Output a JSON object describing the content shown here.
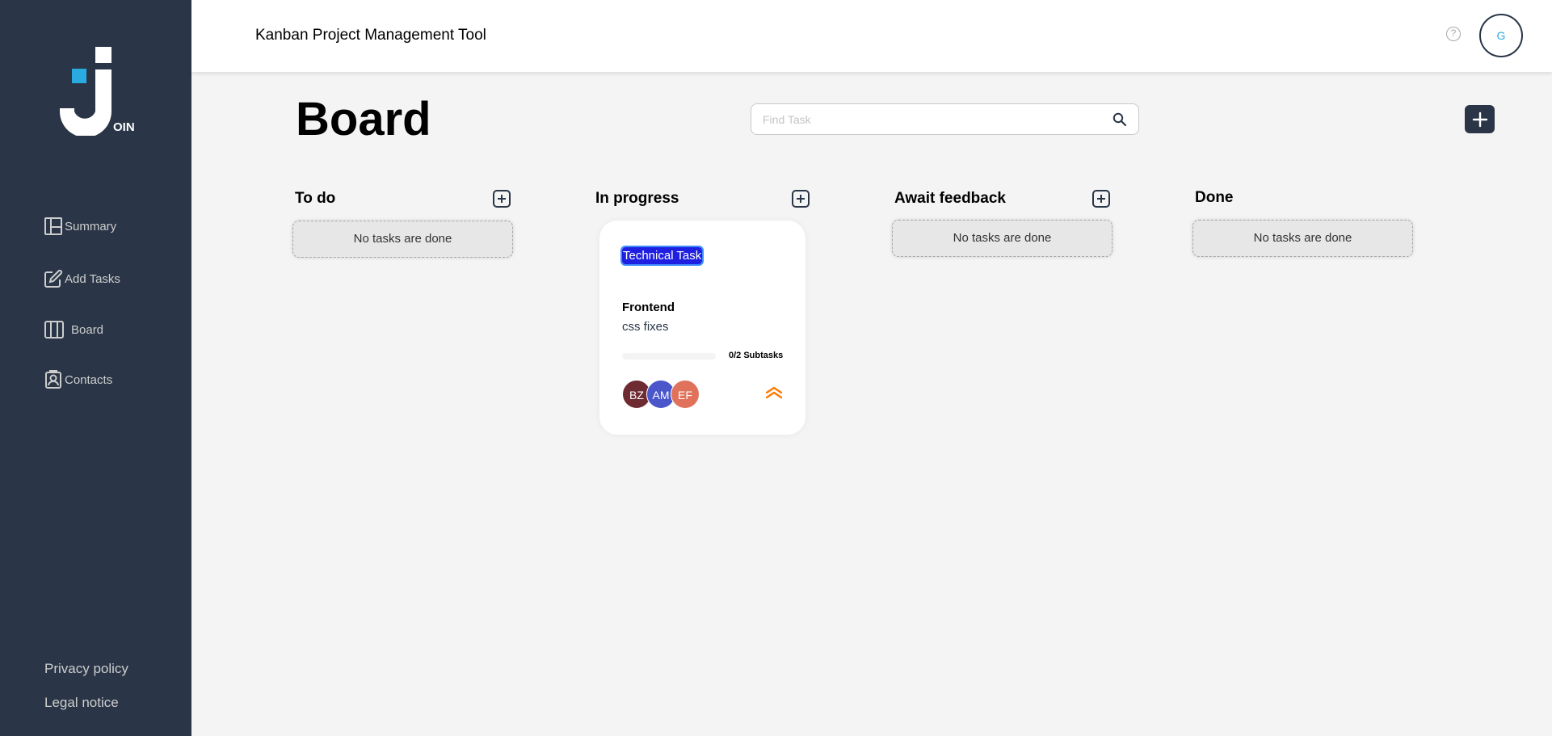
{
  "app": {
    "logo_text": "OIN",
    "header_title": "Kanban Project Management Tool",
    "help_symbol": "?",
    "user_initial": "G"
  },
  "sidebar": {
    "items": [
      {
        "label": "Summary",
        "icon": "summary-icon"
      },
      {
        "label": "Add Tasks",
        "icon": "edit-icon"
      },
      {
        "label": "Board",
        "icon": "board-icon"
      },
      {
        "label": "Contacts",
        "icon": "contacts-icon"
      }
    ],
    "footer": {
      "privacy": "Privacy policy",
      "legal": "Legal notice"
    }
  },
  "board": {
    "title": "Board",
    "search": {
      "placeholder": "Find Task",
      "value": ""
    },
    "add_button": "+",
    "columns": [
      {
        "title": "To do",
        "empty_text": "No tasks are done"
      },
      {
        "title": "In progress"
      },
      {
        "title": "Await feedback",
        "empty_text": "No tasks are done"
      },
      {
        "title": "Done",
        "empty_text": "No tasks are done"
      }
    ]
  },
  "task": {
    "category": "Technical Task",
    "title": "Frontend",
    "description": "css fixes",
    "subtasks_text": "0/2 Subtasks",
    "progress": 0,
    "assignees": [
      {
        "initials": "BZ",
        "color": "#6f2b32"
      },
      {
        "initials": "AM",
        "color": "#4a56c9"
      },
      {
        "initials": "EF",
        "color": "#e0725b"
      }
    ],
    "priority_icon": "urgent-chevrons-icon"
  },
  "colors": {
    "sidebar_bg": "#2a3647",
    "accent": "#29abe2",
    "tag_bg": "#1f1fe2",
    "priority": "#ff7a00"
  }
}
